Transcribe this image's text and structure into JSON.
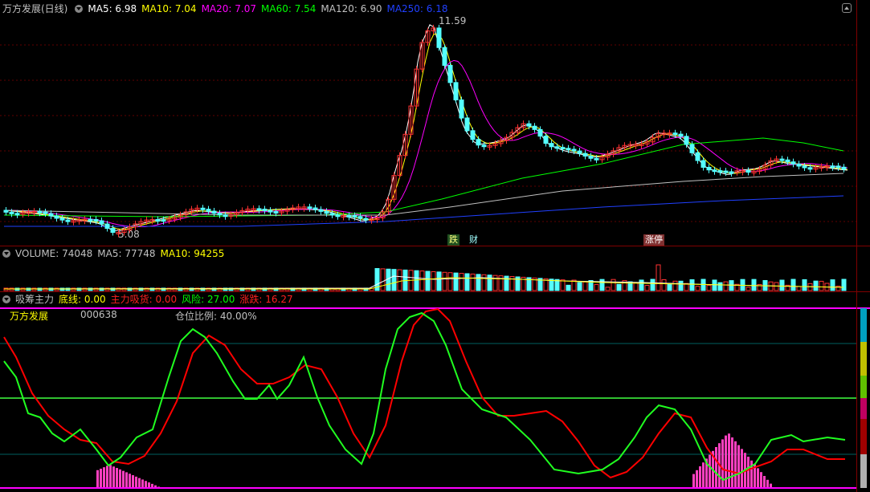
{
  "main": {
    "title": "万方发展(日线)",
    "ma": [
      {
        "label": "MA5: 6.98",
        "color": "#ffffff"
      },
      {
        "label": "MA10: 7.04",
        "color": "#ffff00"
      },
      {
        "label": "MA20: 7.07",
        "color": "#ff00ff"
      },
      {
        "label": "MA60: 7.54",
        "color": "#00ff00"
      },
      {
        "label": "MA120: 6.90",
        "color": "#c0c0c0"
      },
      {
        "label": "MA250: 6.18",
        "color": "#0000ff"
      }
    ],
    "high_label": "11.59",
    "low_label": "5.08",
    "markers": [
      "跌",
      "财",
      "涨停"
    ]
  },
  "volume": {
    "title": "VOLUME: 74048",
    "ma5": "MA5: 77748",
    "ma10": "MA10: 94255"
  },
  "indicator": {
    "name": "吸筹主力",
    "params": [
      {
        "label": "底线: 0.00",
        "color": "#ffff00"
      },
      {
        "label": "主力吸货: 0.00",
        "color": "#ff0000"
      },
      {
        "label": "风险: 27.00",
        "color": "#00ff00"
      },
      {
        "label": "涨跌: 16.27",
        "color": "#ff0000"
      }
    ],
    "stock_name": "万方发展",
    "stock_code": "000638",
    "position_ratio": "仓位比例: 40.00%"
  },
  "colors": {
    "up": "#ff3232",
    "down": "#54ffff",
    "grid": "#800000"
  }
}
